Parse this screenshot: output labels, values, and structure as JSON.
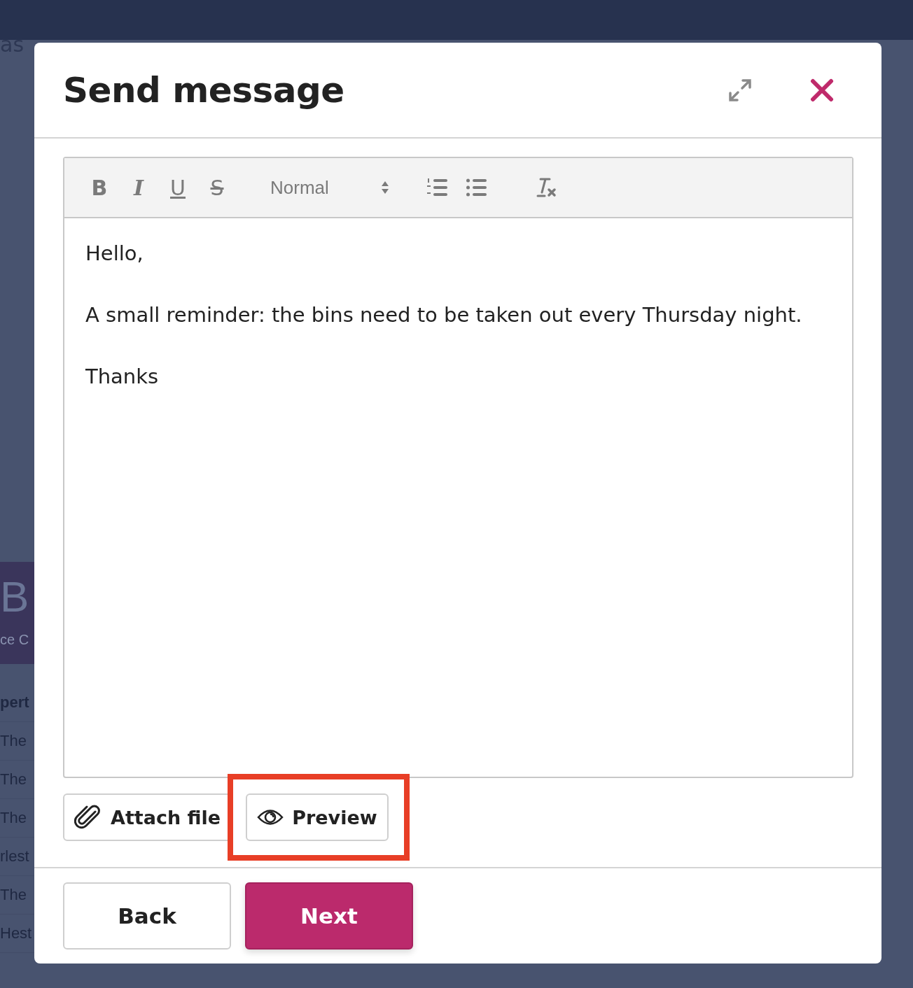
{
  "background": {
    "header_fragment": "as",
    "banner": {
      "letter": "B",
      "caption": "ce C"
    },
    "rows": [
      "pert",
      "The",
      "The",
      "The",
      "rlest",
      "The",
      "Hest"
    ]
  },
  "dialog": {
    "title": "Send message",
    "toolbar": [
      {
        "kind": "bold",
        "label": "B"
      },
      {
        "kind": "italic",
        "label": "I"
      },
      {
        "kind": "underline",
        "label": "U"
      },
      {
        "kind": "strike",
        "label": "S"
      },
      {
        "kind": "select",
        "label": "Normal"
      },
      {
        "kind": "ordered-list"
      },
      {
        "kind": "bullet-list"
      },
      {
        "kind": "clear-format"
      }
    ],
    "paragraphs": [
      "Hello,",
      "A small reminder: the bins need to be taken out every Thursday night.",
      "Thanks"
    ],
    "actions": [
      {
        "kind": "attach",
        "label": "Attach file",
        "highlighted": false
      },
      {
        "kind": "preview",
        "label": "Preview",
        "highlighted": true
      }
    ],
    "footer": [
      {
        "kind": "secondary",
        "label": "Back"
      },
      {
        "kind": "primary",
        "label": "Next"
      }
    ]
  }
}
